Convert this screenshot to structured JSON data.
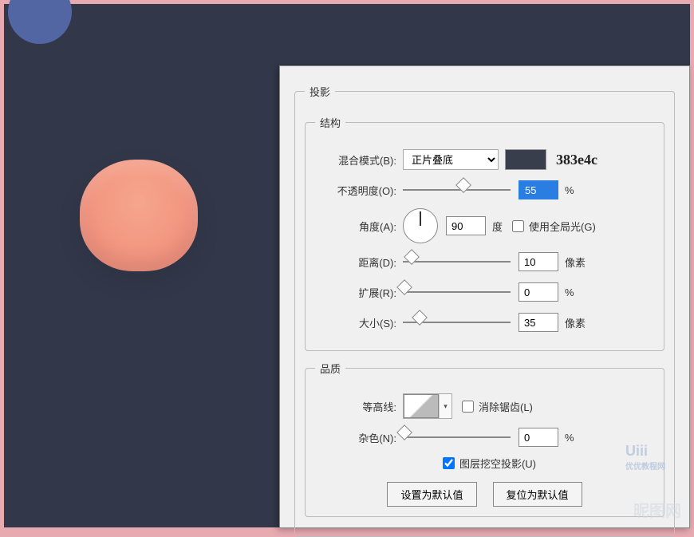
{
  "panel": {
    "title": "投影",
    "structure_title": "结构",
    "quality_title": "品质",
    "blend_mode_label": "混合模式(B):",
    "blend_mode_value": "正片叠底",
    "color_hex": "383e4c",
    "opacity_label": "不透明度(O):",
    "opacity_value": "55",
    "opacity_unit": "%",
    "angle_label": "角度(A):",
    "angle_value": "90",
    "angle_unit": "度",
    "global_light_label": "使用全局光(G)",
    "distance_label": "距离(D):",
    "distance_value": "10",
    "distance_unit": "像素",
    "spread_label": "扩展(R):",
    "spread_value": "0",
    "spread_unit": "%",
    "size_label": "大小(S):",
    "size_value": "35",
    "size_unit": "像素",
    "contour_label": "等高线:",
    "antialias_label": "消除锯齿(L)",
    "noise_label": "杂色(N):",
    "noise_value": "0",
    "noise_unit": "%",
    "knockout_label": "图层挖空投影(U)",
    "set_default_btn": "设置为默认值",
    "reset_default_btn": "复位为默认值"
  },
  "sliders": {
    "opacity_pos": "55%",
    "distance_pos": "7%",
    "spread_pos": "0%",
    "size_pos": "14%",
    "noise_pos": "0%"
  },
  "watermarks": {
    "w1_main": "Uiii",
    "w1_sub": "优优教程网",
    "w2": "昵图网"
  }
}
